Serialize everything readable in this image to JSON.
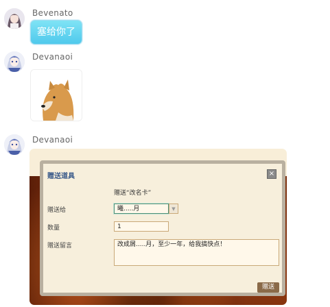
{
  "messages": [
    {
      "sender": "Bevenato",
      "text": "塞给你了"
    },
    {
      "sender": "Devanaoi",
      "sticker": "shiba-dog-sticker"
    },
    {
      "sender": "Devanaoi",
      "screenshot": true
    }
  ],
  "gift_dialog": {
    "title": "赠送道具",
    "close": "×",
    "gift_line": "赠送“改名卡”",
    "to_label": "赠送给",
    "to_value": "曦.....月",
    "dropdown_arrow": "▼",
    "quantity_label": "数量",
    "quantity_value": "1",
    "message_label": "赠送留言",
    "message_value": "改成屑.....月，至少一年，给我搞快点！",
    "send_button": "赠送"
  },
  "colors": {
    "bubble": "#5fd4f0",
    "dialog_title": "#3a5a8a",
    "send_button": "#8a6a48"
  }
}
